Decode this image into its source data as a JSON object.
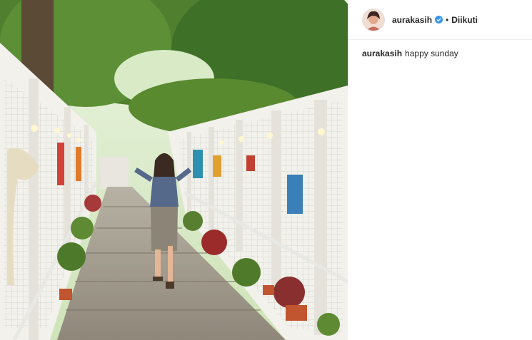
{
  "post": {
    "username": "aurakasih",
    "verified_icon": "verified-badge-icon",
    "separator": "•",
    "follow_status": "Diikuti",
    "caption_user": "aurakasih",
    "caption_text": "happy sunday"
  },
  "colors": {
    "verified": "#3897f0",
    "text": "#262626",
    "divider": "#efefef"
  }
}
